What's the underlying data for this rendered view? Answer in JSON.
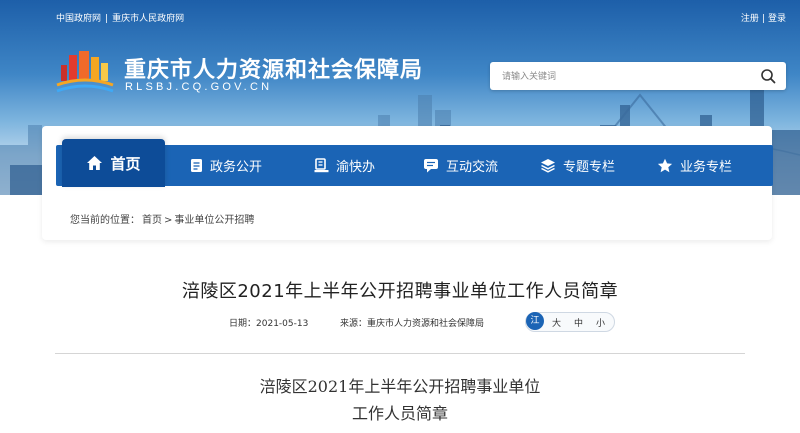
{
  "header": {
    "top_links": [
      "中国政府网",
      "|",
      "重庆市人民政府网"
    ],
    "account": {
      "register": "注册",
      "separator": "|",
      "login": "登录"
    },
    "site_title": "重庆市人力资源和社会保障局",
    "site_subtitle": "RLSBJ.CQ.GOV.CN",
    "search_placeholder": "请输入关键词"
  },
  "nav": {
    "items": [
      {
        "label": "首页",
        "icon": "home-icon",
        "active": true
      },
      {
        "label": "政务公开",
        "icon": "document-icon"
      },
      {
        "label": "渝快办",
        "icon": "service-icon"
      },
      {
        "label": "互动交流",
        "icon": "chat-icon"
      },
      {
        "label": "专题专栏",
        "icon": "layers-icon"
      },
      {
        "label": "业务专栏",
        "icon": "star-icon"
      }
    ]
  },
  "breadcrumb": {
    "prefix": "您当前的位置：",
    "home": "首页",
    "separator": ">",
    "current": "事业单位公开招聘"
  },
  "article": {
    "title": "涪陵区2021年上半年公开招聘事业单位工作人员简章",
    "date_label": "日期：",
    "date": "2021-05-13",
    "source_label": "来源：",
    "source": "重庆市人力资源和社会保障局",
    "share_icon": "江",
    "font_sizes": [
      "大",
      "中",
      "小"
    ],
    "body_heading_line1": "涪陵区2021年上半年公开招聘事业单位",
    "body_heading_line2": "工作人员简章"
  },
  "colors": {
    "nav_blue": "#1b64b5",
    "nav_active": "#0d4c98",
    "banner_top": "#1d5fa9"
  }
}
